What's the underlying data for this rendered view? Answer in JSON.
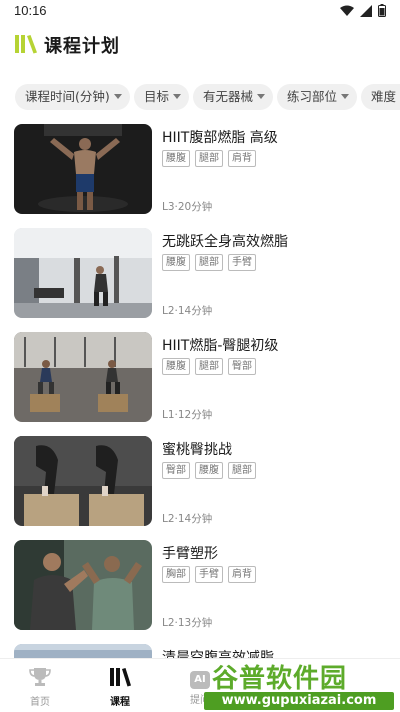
{
  "status_bar": {
    "time": "10:16"
  },
  "header": {
    "title": "课程计划"
  },
  "filters": [
    {
      "label": "课程时间(分钟)"
    },
    {
      "label": "目标"
    },
    {
      "label": "有无器械"
    },
    {
      "label": "练习部位"
    },
    {
      "label": "难度"
    }
  ],
  "courses": [
    {
      "title": "HIIT腹部燃脂 高级",
      "tags": [
        "腰腹",
        "腿部",
        "肩背"
      ],
      "meta": "L3·20分钟"
    },
    {
      "title": "无跳跃全身高效燃脂",
      "tags": [
        "腰腹",
        "腿部",
        "手臂"
      ],
      "meta": "L2·14分钟"
    },
    {
      "title": "HIIT燃脂-臀腿初级",
      "tags": [
        "腰腹",
        "腿部",
        "臀部"
      ],
      "meta": "L1·12分钟"
    },
    {
      "title": "蜜桃臀挑战",
      "tags": [
        "臀部",
        "腰腹",
        "腿部"
      ],
      "meta": "L2·14分钟"
    },
    {
      "title": "手臂塑形",
      "tags": [
        "胸部",
        "手臂",
        "肩背"
      ],
      "meta": "L2·13分钟"
    },
    {
      "title": "清晨空腹高效减脂",
      "tags": [],
      "meta": ""
    }
  ],
  "bottom_nav": [
    {
      "label": "首页",
      "icon": "trophy-icon"
    },
    {
      "label": "课程",
      "icon": "books-icon"
    },
    {
      "label": "提问",
      "icon": "ai-icon",
      "glyph": "AI"
    }
  ],
  "watermark": {
    "title": "谷普软件园",
    "url": "www.gupuxiazai.com"
  },
  "colors": {
    "accent_green": "#b6d334",
    "watermark_green": "#4e9e22"
  }
}
